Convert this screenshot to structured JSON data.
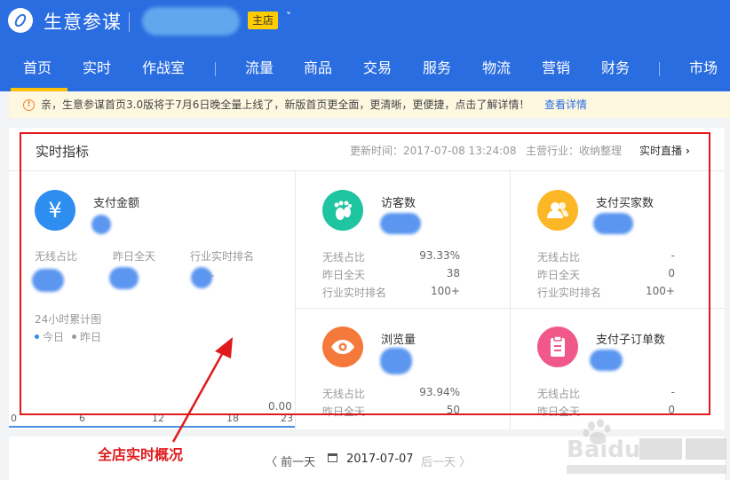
{
  "header": {
    "app_title": "生意参谋",
    "shop_badge": "主店",
    "shop_caret": "˅"
  },
  "nav": {
    "items": [
      "首页",
      "实时",
      "作战室",
      "流量",
      "商品",
      "交易",
      "服务",
      "物流",
      "营销",
      "财务",
      "市场"
    ],
    "active": "首页"
  },
  "notice": {
    "icon": "!",
    "text": "亲，生意参谋首页3.0版将于7月6日晚全量上线了，新版首页更全面，更清晰，更便捷，点击了解详情！",
    "link": "查看详情"
  },
  "realtime": {
    "title": "实时指标",
    "update_time": "更新时间：2017-07-08 13:24:08",
    "industry": "主营行业：收纳整理",
    "live_link": "实时直播",
    "payment": {
      "icon_glyph": "¥",
      "title": "支付金额",
      "labels": [
        "无线占比",
        "昨日全天",
        "行业实时排名"
      ],
      "rank_suffix": "+",
      "chart_title": "24小时累计图",
      "legend_today": "今日",
      "legend_yesterday": "昨日",
      "chart_value": "0.00",
      "ticks": [
        "0",
        "6",
        "12",
        "18",
        "23"
      ]
    },
    "metrics": [
      {
        "title": "访客数",
        "icon": "footprint-icon",
        "color": "#1fc4a0",
        "rows": [
          [
            "无线占比",
            "93.33%"
          ],
          [
            "昨日全天",
            "38"
          ],
          [
            "行业实时排名",
            "100+"
          ]
        ]
      },
      {
        "title": "支付买家数",
        "icon": "users-icon",
        "color": "#fbb726",
        "rows": [
          [
            "无线占比",
            "-"
          ],
          [
            "昨日全天",
            "0"
          ],
          [
            "行业实时排名",
            "100+"
          ]
        ]
      },
      {
        "title": "浏览量",
        "icon": "eye-icon",
        "color": "#f5793a",
        "rows": [
          [
            "无线占比",
            "93.94%"
          ],
          [
            "昨日全天",
            "50"
          ]
        ]
      },
      {
        "title": "支付子订单数",
        "icon": "clipboard-icon",
        "color": "#f0588a",
        "rows": [
          [
            "无线占比",
            "-"
          ],
          [
            "昨日全天",
            "0"
          ]
        ]
      }
    ]
  },
  "annotation": {
    "label": "全店实时概况"
  },
  "date_nav": {
    "prev": "〈 前一天",
    "date": "2017-07-07",
    "next": "后一天 〉"
  },
  "colors": {
    "brand": "#2a6de0",
    "active_tab": "#ffc107",
    "annotation": "#e01a1a"
  }
}
